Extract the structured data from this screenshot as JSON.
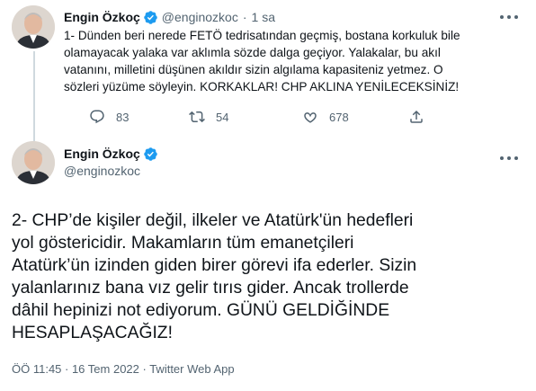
{
  "colors": {
    "text": "#0f1419",
    "muted": "#536471",
    "verified": "#1d9bf0",
    "thread_line": "#cfd9de"
  },
  "parent_tweet": {
    "name": "Engin Özkoç",
    "handle": "@enginozkoc",
    "separator": "·",
    "time": "1 sa",
    "text_lines": [
      "1- Dünden beri nerede FETÖ tedrisatından geçmiş, bostana korkuluk bile",
      "olamayacak yalaka var aklımla sözde dalga geçiyor. Yalakalar, bu akıl",
      "vatanını, milletini düşünen akıldır sizin algılama kapasiteniz yetmez. O",
      "sözleri yüzüme söyleyin. KORKAKLAR! CHP AKLINA YENİLECEKSİNİZ!"
    ],
    "actions": {
      "reply_icon": "reply-icon",
      "reply_count": "83",
      "retweet_icon": "retweet-icon",
      "retweet_count": "54",
      "like_icon": "heart-icon",
      "like_count": "678",
      "share_icon": "share-icon"
    }
  },
  "main_tweet": {
    "name": "Engin Özkoç",
    "handle": "@enginozkoc",
    "text_lines": [
      "2- CHP’de kişiler değil, ilkeler ve Atatürk'ün hedefleri",
      "yol göstericidir. Makamların tüm emanetçileri",
      "Atatürk’ün izinden giden birer görevi ifa ederler. Sizin",
      "yalanlarınız bana vız gelir tırıs gider. Ancak trollerde",
      "dâhil hepinizi not ediyorum. GÜNÜ GELDİĞİNDE",
      "HESAPLAŞACAĞIZ!"
    ],
    "timestamp": "ÖÖ 11:45 · 16 Tem 2022 · Twitter Web App"
  }
}
